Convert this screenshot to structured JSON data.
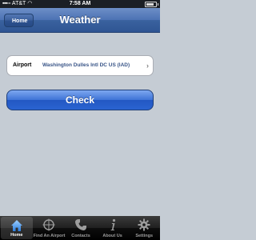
{
  "status_bar": {
    "carrier": "AT&T",
    "time": "7:58 AM"
  },
  "nav_bar": {
    "back_label": "Home",
    "title": "Weather"
  },
  "form": {
    "airport_label": "Airport",
    "airport_value": "Washington Dulles Intl DC US (IAD)"
  },
  "check_button": {
    "label": "Check"
  },
  "tab_bar": {
    "tabs": [
      {
        "label": "Home",
        "icon": "home-icon",
        "active": true
      },
      {
        "label": "Find An Airport",
        "icon": "target-icon",
        "active": false
      },
      {
        "label": "Contacts",
        "icon": "phone-icon",
        "active": false
      },
      {
        "label": "About Us",
        "icon": "info-icon",
        "active": false
      },
      {
        "label": "Settings",
        "icon": "gear-icon",
        "active": false
      }
    ]
  },
  "colors": {
    "nav_blue": "#3a629f",
    "button_blue": "#2358c3",
    "background": "#c5ccd4",
    "airport_value_text": "#385487"
  }
}
